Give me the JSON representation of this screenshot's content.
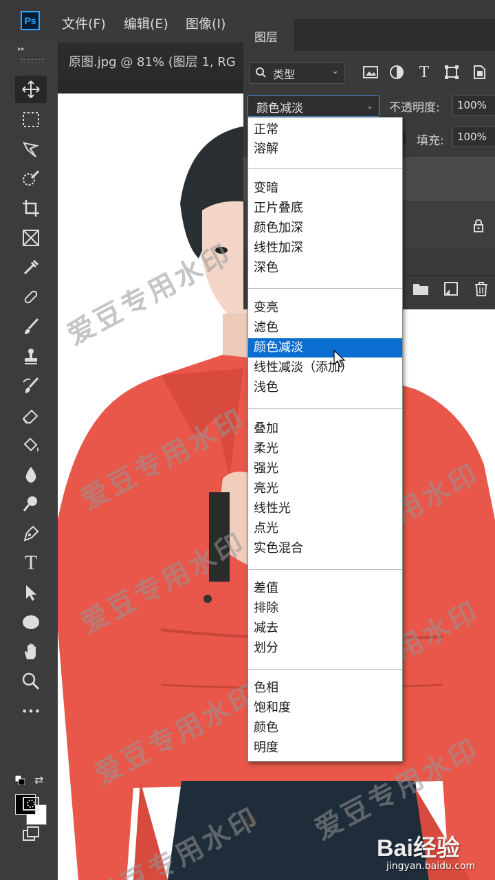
{
  "menubar": {
    "app_logo": "Ps",
    "items": [
      "文件(F)",
      "编辑(E)",
      "图像(I)"
    ]
  },
  "document": {
    "tab_title": "原图.jpg @ 81% (图层 1, RG"
  },
  "toolbar": {
    "collapse": "▸▸",
    "tools": [
      "move-icon",
      "marquee-icon",
      "lasso-icon",
      "quick-select-icon",
      "crop-icon",
      "frame-icon",
      "eyedropper-icon",
      "healing-brush-icon",
      "brush-icon",
      "clone-stamp-icon",
      "history-brush-icon",
      "eraser-icon",
      "paint-bucket-icon",
      "blur-icon",
      "dodge-icon",
      "pen-icon",
      "type-icon",
      "path-select-icon",
      "ellipse-icon",
      "hand-icon",
      "zoom-icon",
      "more-tools-icon"
    ],
    "type_glyph": "T",
    "more_glyph": "•••",
    "swap_glyph": "⇄",
    "foreground_color": "#000000",
    "background_color": "#ffffff"
  },
  "layers_panel": {
    "tab_label": "图层",
    "filter_label": "类型",
    "blend_mode": "颜色减淡",
    "opacity_label": "不透明度:",
    "opacity_value": "100%",
    "fill_label": "填充:",
    "fill_value": "100%"
  },
  "blend_dropdown": {
    "groups": [
      [
        "正常",
        "溶解"
      ],
      [
        "变暗",
        "正片叠底",
        "颜色加深",
        "线性加深",
        "深色"
      ],
      [
        "变亮",
        "滤色",
        "颜色减淡",
        "线性减淡（添加）",
        "浅色"
      ],
      [
        "叠加",
        "柔光",
        "强光",
        "亮光",
        "线性光",
        "点光",
        "实色混合"
      ],
      [
        "差值",
        "排除",
        "减去",
        "划分"
      ],
      [
        "色相",
        "饱和度",
        "颜色",
        "明度"
      ]
    ],
    "selected": "颜色减淡",
    "selected_color": "#0a6ed1"
  },
  "watermark": {
    "text": "爱豆专用水印",
    "site_logo": "Bai经验",
    "site_url": "jingyan.baidu.com"
  },
  "colors": {
    "jacket": "#e8574a",
    "hair": "#2a2f33"
  }
}
